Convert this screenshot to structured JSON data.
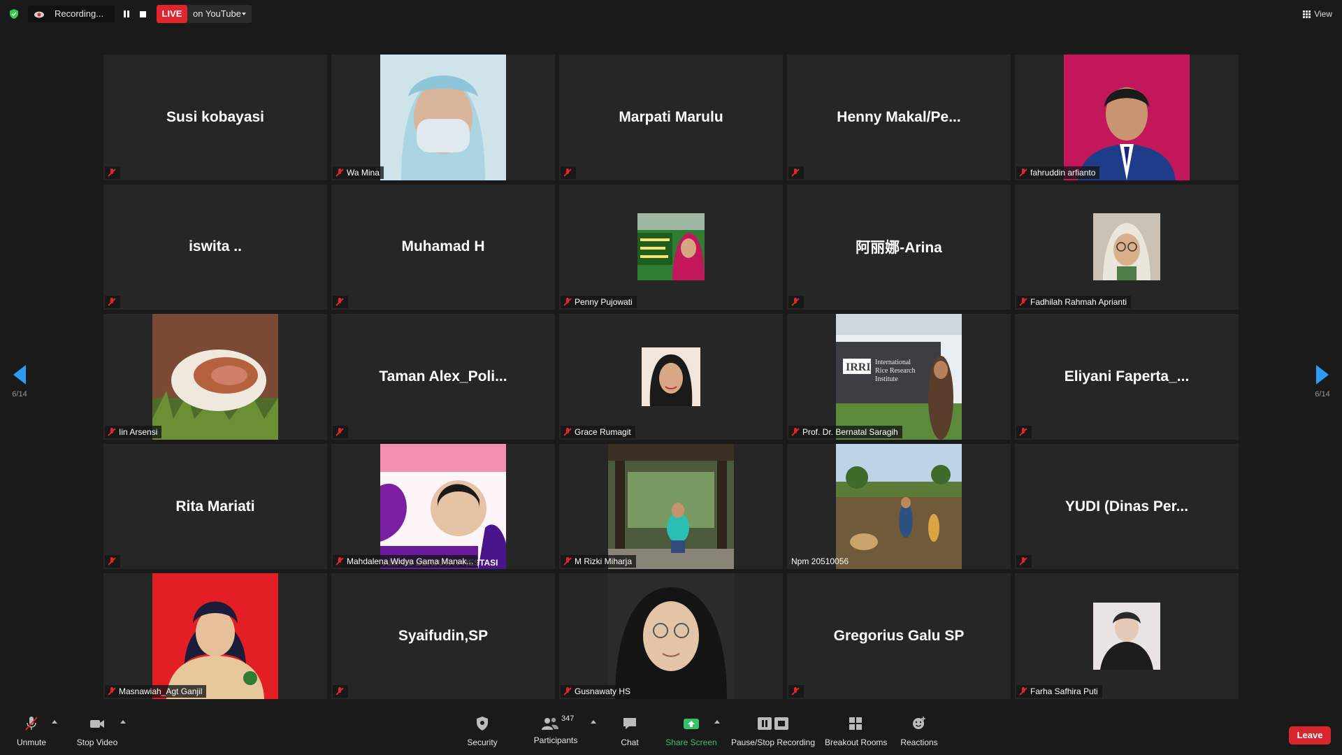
{
  "topbar": {
    "recording_label": "Recording...",
    "live_label": "LIVE",
    "live_destination": "on YouTube",
    "view_label": "View"
  },
  "pagination": {
    "left": "6/14",
    "right": "6/14"
  },
  "participants": [
    {
      "name": "Susi kobayasi",
      "kind": "name"
    },
    {
      "name": "Wa Mina",
      "kind": "video",
      "visual": "masked-nurse-photo"
    },
    {
      "name": "Marpati Marulu",
      "kind": "name"
    },
    {
      "name": "Henny  Makal/Pe...",
      "kind": "name"
    },
    {
      "name": "fahruddin arfianto",
      "kind": "video",
      "visual": "formal-portrait-red-bg"
    },
    {
      "name": "iswita ..",
      "kind": "name"
    },
    {
      "name": "Muhamad H",
      "kind": "name"
    },
    {
      "name": "Penny Pujowati",
      "kind": "thumb",
      "visual": "hijab-sign-photo"
    },
    {
      "name": "阿丽娜-Arina",
      "kind": "name"
    },
    {
      "name": "Fadhilah Rahmah Aprianti",
      "kind": "thumb",
      "visual": "hijab-glasses-photo"
    },
    {
      "name": "Iin Arsensi",
      "kind": "video",
      "visual": "mushroom-photo"
    },
    {
      "name": "Taman  Alex_Poli...",
      "kind": "name"
    },
    {
      "name": "Grace Rumagit",
      "kind": "small",
      "visual": "woman-portrait-photo"
    },
    {
      "name": "Prof. Dr. Bernatal Saragih",
      "kind": "video",
      "visual": "irri-sign-photo",
      "sign_title": "IRRI",
      "sign_text": "International Rice Research Institute"
    },
    {
      "name": "Eliyani  Faperta_...",
      "kind": "name"
    },
    {
      "name": "Rita Mariati",
      "kind": "name"
    },
    {
      "name": "Mahdalena Widya Gama Manak...",
      "kind": "video",
      "visual": "campus-poster",
      "poster_text": "AMPUS BERJUTA PRESTASI"
    },
    {
      "name": "M Rizki Miharja",
      "kind": "video",
      "visual": "pavilion-photo"
    },
    {
      "name": "Npm 20510056",
      "kind": "video",
      "visual": "field-photo",
      "plain_label": true
    },
    {
      "name": "YUDI  (Dinas Per...",
      "kind": "name"
    },
    {
      "name": "Masnawiah_Agt Ganjil",
      "kind": "video",
      "visual": "student-portrait-red-bg"
    },
    {
      "name": "Syaifudin,SP",
      "kind": "name"
    },
    {
      "name": "Gusnawaty HS",
      "kind": "video",
      "visual": "hijab-woman-photo"
    },
    {
      "name": "Gregorius Galu SP",
      "kind": "name"
    },
    {
      "name": "Farha Safhira Puti",
      "kind": "thumb",
      "visual": "dark-scarf-photo"
    }
  ],
  "toolbar": {
    "unmute": "Unmute",
    "stop_video": "Stop Video",
    "security": "Security",
    "participants_label": "Participants",
    "participants_count": "347",
    "chat": "Chat",
    "share_screen": "Share Screen",
    "pause_stop_recording": "Pause/Stop Recording",
    "breakout_rooms": "Breakout Rooms",
    "reactions": "Reactions",
    "leave": "Leave"
  },
  "colors": {
    "live_red": "#e0262d",
    "share_green": "#37c26a",
    "arrow_blue": "#2a9cf7",
    "tile_bg": "#262626"
  }
}
